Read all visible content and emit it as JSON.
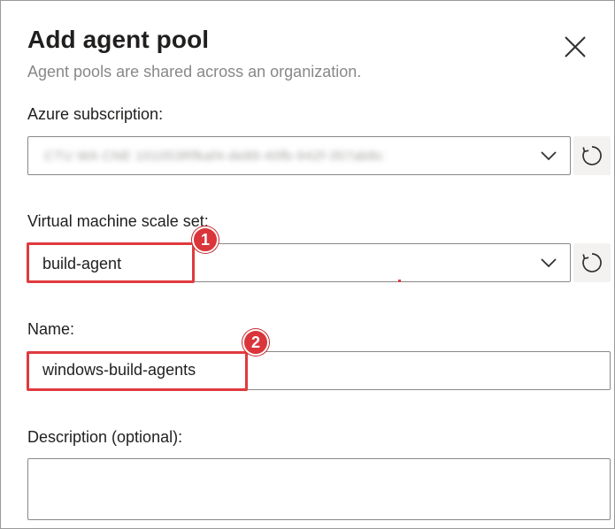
{
  "dialog": {
    "title": "Add agent pool",
    "subtitle": "Agent pools are shared across an organization."
  },
  "fields": {
    "azure_subscription": {
      "label": "Azure subscription:",
      "value": "CTU WA CNE 101053Rfkaf4-de89-40fb-942f-357ab8c"
    },
    "vm_scale_set": {
      "label": "Virtual machine scale set:",
      "value": "build-agent"
    },
    "name": {
      "label": "Name:",
      "value": "windows-build-agents"
    },
    "description": {
      "label": "Description (optional):",
      "value": ""
    }
  },
  "annotations": [
    {
      "number": "1"
    },
    {
      "number": "2"
    }
  ],
  "icons": {
    "close": "close-icon",
    "chevron": "chevron-down-icon",
    "refresh": "refresh-icon"
  },
  "colors": {
    "highlight": "#e03a3e",
    "marker": "#d9353b",
    "border": "#8a8886",
    "subtitle": "#8a8886"
  }
}
